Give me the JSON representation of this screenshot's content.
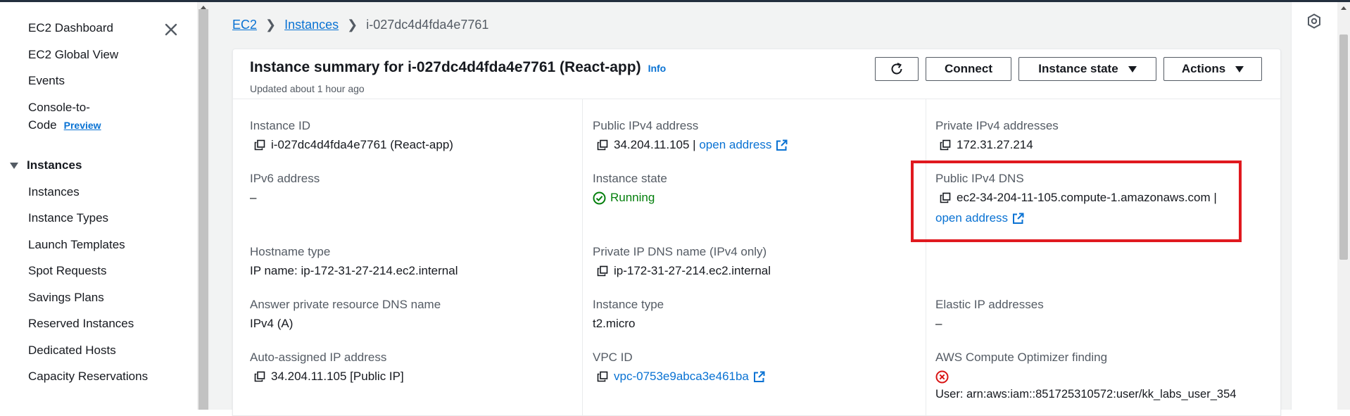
{
  "sidebar": {
    "items_top": [
      {
        "label": "EC2 Dashboard"
      },
      {
        "label": "EC2 Global View"
      },
      {
        "label": "Events"
      }
    ],
    "console_to_code": {
      "line1": "Console-to-",
      "line2": "Code",
      "badge": "Preview"
    },
    "section": {
      "label": "Instances"
    },
    "section_items": [
      {
        "label": "Instances"
      },
      {
        "label": "Instance Types"
      },
      {
        "label": "Launch Templates"
      },
      {
        "label": "Spot Requests"
      },
      {
        "label": "Savings Plans"
      },
      {
        "label": "Reserved Instances"
      },
      {
        "label": "Dedicated Hosts"
      },
      {
        "label": "Capacity Reservations"
      }
    ]
  },
  "breadcrumb": {
    "root": "EC2",
    "parent": "Instances",
    "current": "i-027dc4d4fda4e7761"
  },
  "summary": {
    "title": "Instance summary for i-027dc4d4fda4e7761 (React-app)",
    "info": "Info",
    "updated": "Updated about 1 hour ago",
    "buttons": {
      "connect": "Connect",
      "instance_state": "Instance state",
      "actions": "Actions"
    }
  },
  "fields": {
    "instance_id": {
      "label": "Instance ID",
      "value": "i-027dc4d4fda4e7761 (React-app)"
    },
    "public_ipv4": {
      "label": "Public IPv4 address",
      "value": "34.204.11.105 |",
      "link": "open address"
    },
    "private_ipv4": {
      "label": "Private IPv4 addresses",
      "value": "172.31.27.214"
    },
    "ipv6": {
      "label": "IPv6 address",
      "value": "–"
    },
    "instance_state": {
      "label": "Instance state",
      "value": "Running"
    },
    "public_dns": {
      "label": "Public IPv4 DNS",
      "value": "ec2-34-204-11-105.compute-1.amazonaws.com |",
      "link": "open address"
    },
    "hostname_type": {
      "label": "Hostname type",
      "value": "IP name: ip-172-31-27-214.ec2.internal"
    },
    "private_dns": {
      "label": "Private IP DNS name (IPv4 only)",
      "value": "ip-172-31-27-214.ec2.internal"
    },
    "answer_dns": {
      "label": "Answer private resource DNS name",
      "value": "IPv4 (A)"
    },
    "instance_type": {
      "label": "Instance type",
      "value": "t2.micro"
    },
    "elastic_ip": {
      "label": "Elastic IP addresses",
      "value": "–"
    },
    "auto_ip": {
      "label": "Auto-assigned IP address",
      "value": "34.204.11.105 [Public IP]"
    },
    "vpc_id": {
      "label": "VPC ID",
      "value": "vpc-0753e9abca3e461ba"
    },
    "optimizer": {
      "label": "AWS Compute Optimizer finding",
      "value": "User: arn:aws:iam::851725310572:user/kk_labs_user_354"
    }
  },
  "colors": {
    "link": "#0972d3",
    "running": "#037f0c",
    "error": "#d91515",
    "highlight": "#e0191f"
  }
}
